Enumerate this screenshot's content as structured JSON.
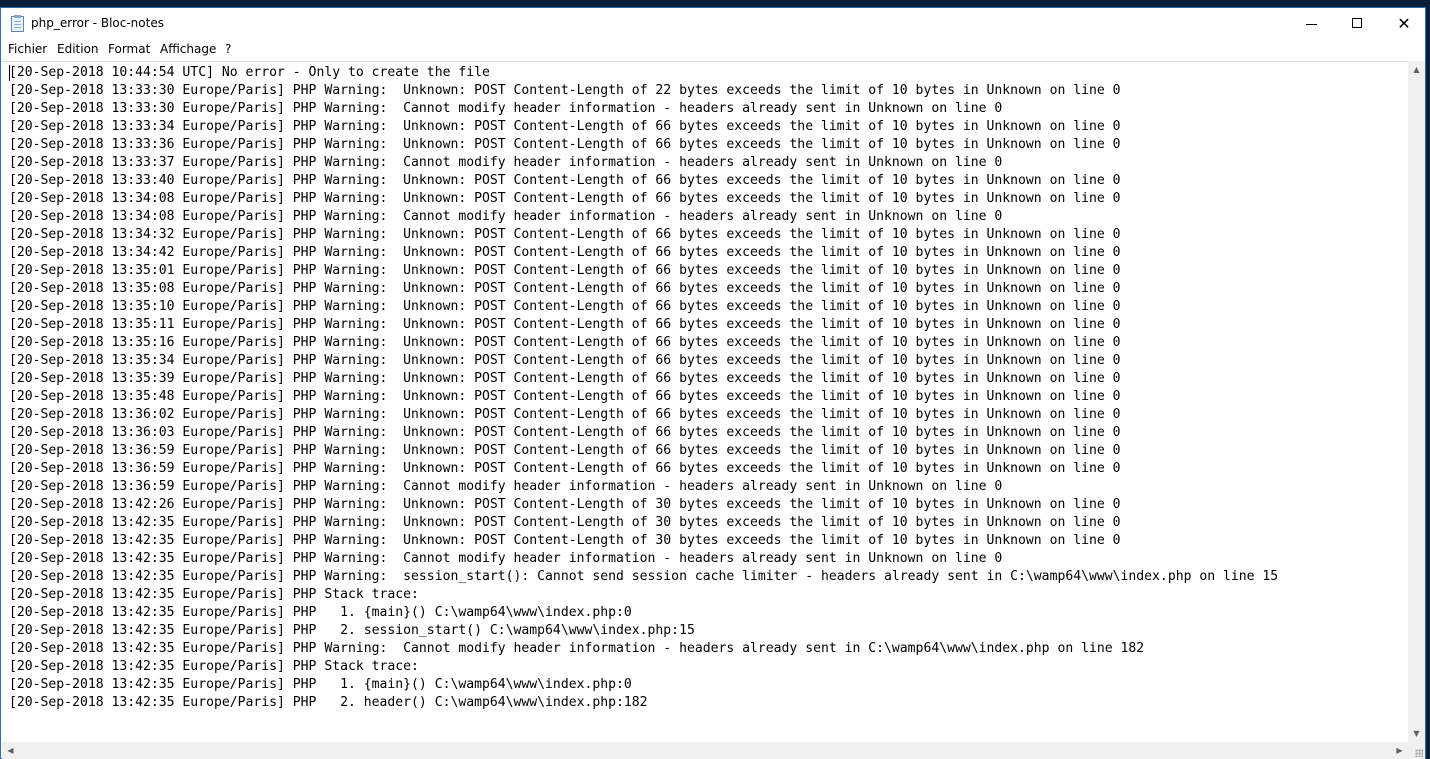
{
  "window": {
    "title": "php_error - Bloc-notes",
    "controls": {
      "minimize": "",
      "maximize": "",
      "close": "✕"
    }
  },
  "menu": {
    "items": [
      "Fichier",
      "Edition",
      "Format",
      "Affichage",
      "?"
    ]
  },
  "editor": {
    "lines": [
      "[20-Sep-2018 10:44:54 UTC] No error - Only to create the file",
      "[20-Sep-2018 13:33:30 Europe/Paris] PHP Warning:  Unknown: POST Content-Length of 22 bytes exceeds the limit of 10 bytes in Unknown on line 0",
      "[20-Sep-2018 13:33:30 Europe/Paris] PHP Warning:  Cannot modify header information - headers already sent in Unknown on line 0",
      "[20-Sep-2018 13:33:34 Europe/Paris] PHP Warning:  Unknown: POST Content-Length of 66 bytes exceeds the limit of 10 bytes in Unknown on line 0",
      "[20-Sep-2018 13:33:36 Europe/Paris] PHP Warning:  Unknown: POST Content-Length of 66 bytes exceeds the limit of 10 bytes in Unknown on line 0",
      "[20-Sep-2018 13:33:37 Europe/Paris] PHP Warning:  Cannot modify header information - headers already sent in Unknown on line 0",
      "[20-Sep-2018 13:33:40 Europe/Paris] PHP Warning:  Unknown: POST Content-Length of 66 bytes exceeds the limit of 10 bytes in Unknown on line 0",
      "[20-Sep-2018 13:34:08 Europe/Paris] PHP Warning:  Unknown: POST Content-Length of 66 bytes exceeds the limit of 10 bytes in Unknown on line 0",
      "[20-Sep-2018 13:34:08 Europe/Paris] PHP Warning:  Cannot modify header information - headers already sent in Unknown on line 0",
      "[20-Sep-2018 13:34:32 Europe/Paris] PHP Warning:  Unknown: POST Content-Length of 66 bytes exceeds the limit of 10 bytes in Unknown on line 0",
      "[20-Sep-2018 13:34:42 Europe/Paris] PHP Warning:  Unknown: POST Content-Length of 66 bytes exceeds the limit of 10 bytes in Unknown on line 0",
      "[20-Sep-2018 13:35:01 Europe/Paris] PHP Warning:  Unknown: POST Content-Length of 66 bytes exceeds the limit of 10 bytes in Unknown on line 0",
      "[20-Sep-2018 13:35:08 Europe/Paris] PHP Warning:  Unknown: POST Content-Length of 66 bytes exceeds the limit of 10 bytes in Unknown on line 0",
      "[20-Sep-2018 13:35:10 Europe/Paris] PHP Warning:  Unknown: POST Content-Length of 66 bytes exceeds the limit of 10 bytes in Unknown on line 0",
      "[20-Sep-2018 13:35:11 Europe/Paris] PHP Warning:  Unknown: POST Content-Length of 66 bytes exceeds the limit of 10 bytes in Unknown on line 0",
      "[20-Sep-2018 13:35:16 Europe/Paris] PHP Warning:  Unknown: POST Content-Length of 66 bytes exceeds the limit of 10 bytes in Unknown on line 0",
      "[20-Sep-2018 13:35:34 Europe/Paris] PHP Warning:  Unknown: POST Content-Length of 66 bytes exceeds the limit of 10 bytes in Unknown on line 0",
      "[20-Sep-2018 13:35:39 Europe/Paris] PHP Warning:  Unknown: POST Content-Length of 66 bytes exceeds the limit of 10 bytes in Unknown on line 0",
      "[20-Sep-2018 13:35:48 Europe/Paris] PHP Warning:  Unknown: POST Content-Length of 66 bytes exceeds the limit of 10 bytes in Unknown on line 0",
      "[20-Sep-2018 13:36:02 Europe/Paris] PHP Warning:  Unknown: POST Content-Length of 66 bytes exceeds the limit of 10 bytes in Unknown on line 0",
      "[20-Sep-2018 13:36:03 Europe/Paris] PHP Warning:  Unknown: POST Content-Length of 66 bytes exceeds the limit of 10 bytes in Unknown on line 0",
      "[20-Sep-2018 13:36:59 Europe/Paris] PHP Warning:  Unknown: POST Content-Length of 66 bytes exceeds the limit of 10 bytes in Unknown on line 0",
      "[20-Sep-2018 13:36:59 Europe/Paris] PHP Warning:  Unknown: POST Content-Length of 66 bytes exceeds the limit of 10 bytes in Unknown on line 0",
      "[20-Sep-2018 13:36:59 Europe/Paris] PHP Warning:  Cannot modify header information - headers already sent in Unknown on line 0",
      "[20-Sep-2018 13:42:26 Europe/Paris] PHP Warning:  Unknown: POST Content-Length of 30 bytes exceeds the limit of 10 bytes in Unknown on line 0",
      "[20-Sep-2018 13:42:35 Europe/Paris] PHP Warning:  Unknown: POST Content-Length of 30 bytes exceeds the limit of 10 bytes in Unknown on line 0",
      "[20-Sep-2018 13:42:35 Europe/Paris] PHP Warning:  Unknown: POST Content-Length of 30 bytes exceeds the limit of 10 bytes in Unknown on line 0",
      "[20-Sep-2018 13:42:35 Europe/Paris] PHP Warning:  Cannot modify header information - headers already sent in Unknown on line 0",
      "[20-Sep-2018 13:42:35 Europe/Paris] PHP Warning:  session_start(): Cannot send session cache limiter - headers already sent in C:\\wamp64\\www\\index.php on line 15",
      "[20-Sep-2018 13:42:35 Europe/Paris] PHP Stack trace:",
      "[20-Sep-2018 13:42:35 Europe/Paris] PHP   1. {main}() C:\\wamp64\\www\\index.php:0",
      "[20-Sep-2018 13:42:35 Europe/Paris] PHP   2. session_start() C:\\wamp64\\www\\index.php:15",
      "[20-Sep-2018 13:42:35 Europe/Paris] PHP Warning:  Cannot modify header information - headers already sent in C:\\wamp64\\www\\index.php on line 182",
      "[20-Sep-2018 13:42:35 Europe/Paris] PHP Stack trace:",
      "[20-Sep-2018 13:42:35 Europe/Paris] PHP   1. {main}() C:\\wamp64\\www\\index.php:0",
      "[20-Sep-2018 13:42:35 Europe/Paris] PHP   2. header() C:\\wamp64\\www\\index.php:182"
    ]
  },
  "scrollbars": {
    "up": "▲",
    "down": "▼",
    "left": "◀",
    "right": "▶"
  },
  "colors": {
    "desktop": "#0b1e3a",
    "window_border": "#2b6fb0",
    "scrollbar_bg": "#f0f0f0"
  }
}
